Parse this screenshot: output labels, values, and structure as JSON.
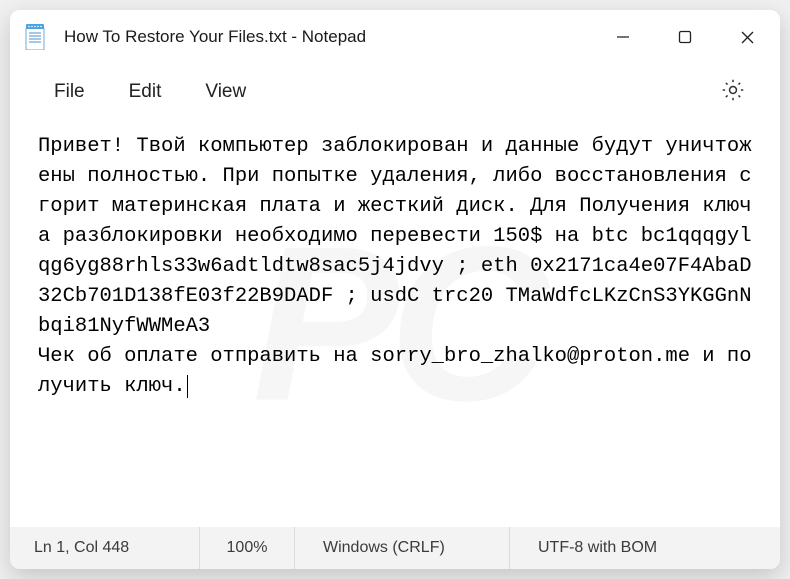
{
  "window": {
    "title": "How To Restore Your Files.txt - Notepad"
  },
  "menu": {
    "file": "File",
    "edit": "Edit",
    "view": "View"
  },
  "content": {
    "text": "Привет! Твой компьютер заблокирован и данные будут уничтожены полностью. При попытке удаления, либо восстановления сгорит материнская плата и жесткий диск. Для Получения ключа разблокировки необходимо перевести 150$ на btc bc1qqqgylqg6yg88rhls33w6adtldtw8sac5j4jdvy ; eth 0x2171ca4e07F4AbaD32Cb701D138fE03f22B9DADF ; usdC trc20 TMaWdfcLKzCnS3YKGGnNbqi81NyfWWMeA3\nЧек об оплате отправить на sorry_bro_zhalko@proton.me и получить ключ."
  },
  "statusbar": {
    "position": "Ln 1, Col 448",
    "zoom": "100%",
    "eol": "Windows (CRLF)",
    "encoding": "UTF-8 with BOM"
  }
}
